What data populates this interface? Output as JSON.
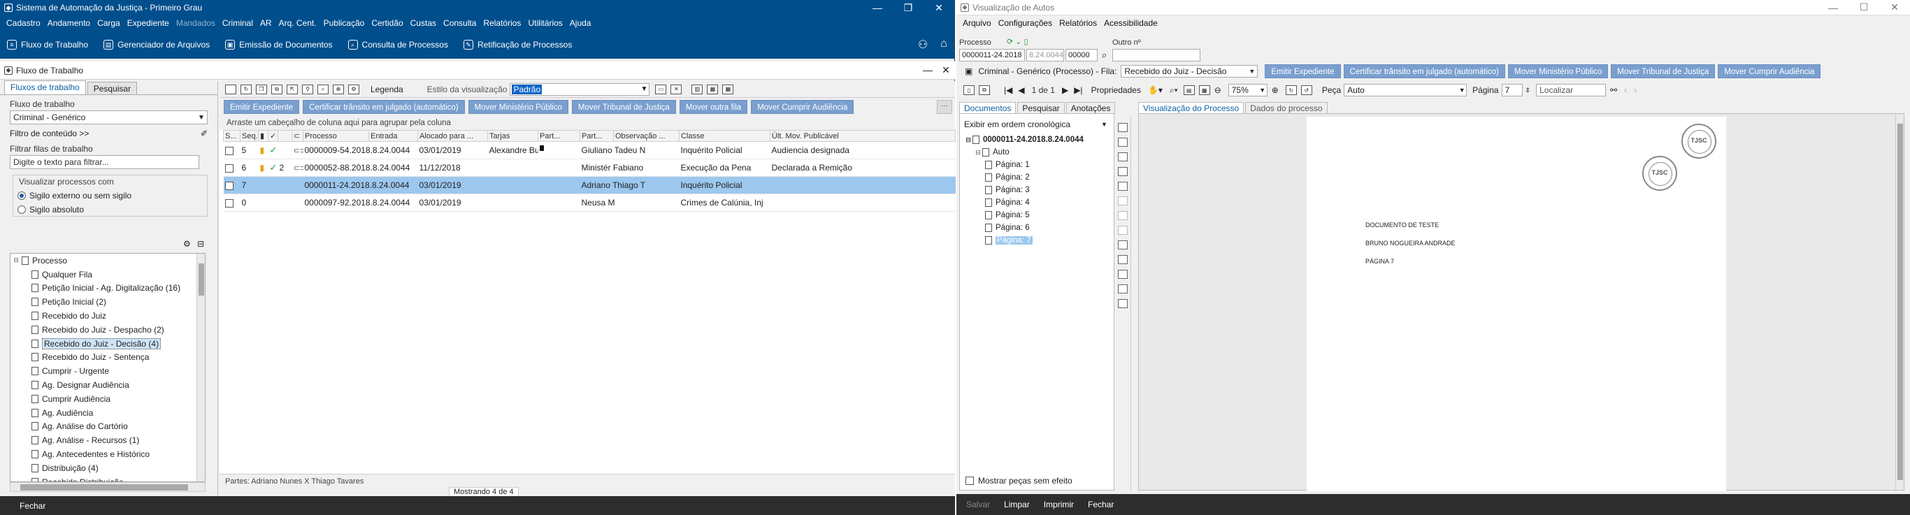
{
  "left_window": {
    "title": "Sistema de Automação da Justiça - Primeiro Grau",
    "controls": [
      "—",
      "❐",
      "✕"
    ],
    "menu": [
      "Cadastro",
      "Andamento",
      "Carga",
      "Expediente",
      "Mandados",
      "Criminal",
      "AR",
      "Arq. Cent.",
      "Publicação",
      "Certidão",
      "Custas",
      "Consulta",
      "Relatórios",
      "Utilitários",
      "Ajuda"
    ],
    "quickbar": [
      {
        "label": "Fluxo de Trabalho",
        "icon": "workflow-icon"
      },
      {
        "label": "Gerenciador de Arquivos",
        "icon": "files-icon"
      },
      {
        "label": "Emissão de Documentos",
        "icon": "document-icon"
      },
      {
        "label": "Consulta de Processos",
        "icon": "search-icon"
      },
      {
        "label": "Retificação de Processos",
        "icon": "edit-icon"
      }
    ],
    "subwindow_title": "Fluxo de Trabalho",
    "side": {
      "tabs": [
        "Fluxos de trabalho",
        "Pesquisar"
      ],
      "fluxo_label": "Fluxo de trabalho",
      "fluxo_value": "Criminal - Genérico",
      "filtro_conteudo": "Filtro de conteúdo >>",
      "filtrar_label": "Filtrar filas de trabalho",
      "filtrar_placeholder": "Digite o texto para filtrar...",
      "visualizar_title": "Visualizar processos com",
      "radio1": "Sigilo externo ou sem sigilo",
      "radio2": "Sigilo absoluto",
      "tree_root": "Processo",
      "tree_items": [
        "Qualquer Fila",
        "Petição Inicial - Ag. Digitalização (16)",
        "Petição Inicial (2)",
        "Recebido do Juiz",
        "Recebido do Juiz - Despacho (2)",
        "Recebido do Juiz - Decisão (4)",
        "Recebido do Juiz - Sentença",
        "Cumprir - Urgente",
        "Ag. Designar Audiência",
        "Cumprir Audiência",
        "Ag. Audiência",
        "Ag. Análise do Cartório",
        "Ag. Análise - Recursos (1)",
        "Ag. Antecedentes e Histórico",
        "Distribuição (4)",
        "Recebido Distribuição"
      ],
      "selected_index": 5
    },
    "toolbar": {
      "legend": "Legenda",
      "estilo_label": "Estilo da visualização",
      "estilo_value": "Padrão"
    },
    "actions": [
      "Emitir Expediente",
      "Certificar trânsito em julgado (automático)",
      "Mover Ministério Público",
      "Mover Tribunal de Justiça",
      "Mover outra fila",
      "Mover Cumprir Audiência"
    ],
    "group_hint": "Arraste um cabeçalho de coluna aqui para agrupar pela coluna",
    "columns": [
      "S...",
      "Seq.",
      "",
      "",
      "",
      "Processo",
      "Entrada",
      "Alocado para ...",
      "Tarjas",
      "Part...",
      "Part...",
      "Observação ...",
      "Classe",
      "Últ. Mov. Publicável"
    ],
    "rows": [
      {
        "seq": "5",
        "flag": true,
        "check": true,
        "num": "",
        "clip": true,
        "processo": "0000009-54.2018.8.24.0044",
        "entrada": "03/01/2019",
        "alocado": "Alexandre Buzan",
        "tarja": true,
        "parte": "Giuliano Tadeu N",
        "classe": "Inquérito Policial",
        "ultmov": "Audiencia designada",
        "selected": false
      },
      {
        "seq": "6",
        "flag": true,
        "check": true,
        "num": "2",
        "clip": true,
        "processo": "0000052-88.2018.8.24.0044",
        "entrada": "11/12/2018",
        "alocado": "",
        "tarja": false,
        "parte": "Ministér Fabiano",
        "classe": "Execução da Pena",
        "ultmov": "Declarada a Remição",
        "selected": false
      },
      {
        "seq": "7",
        "flag": false,
        "check": false,
        "num": "",
        "clip": false,
        "processo": "0000011-24.2018.8.24.0044",
        "entrada": "03/01/2019",
        "alocado": "",
        "tarja": false,
        "parte": "Adriano Thiago T",
        "classe": "Inquérito Policial",
        "ultmov": "",
        "selected": true
      },
      {
        "seq": "0",
        "flag": false,
        "check": false,
        "num": "",
        "clip": false,
        "processo": "0000097-92.2018.8.24.0044",
        "entrada": "03/01/2019",
        "alocado": "",
        "tarja": false,
        "parte": "Neusa M",
        "classe": "Crimes de Calúnia, Inj",
        "ultmov": "",
        "selected": false
      }
    ],
    "partes": "Partes: Adriano Nunes  X  Thiago Tavares",
    "mostrando": "Mostrando 4 de 4",
    "footer_close": "Fechar"
  },
  "right_window": {
    "title": "Visualização de Autos",
    "menu": [
      "Arquivo",
      "Configurações",
      "Relatórios",
      "Acessibilidade"
    ],
    "processo_label": "Processo",
    "outro_label": "Outro nº",
    "processo_parts": [
      "0000011-24.2018",
      "8.24.0044",
      "00000"
    ],
    "fila_path": "Criminal - Genérico (Processo) - Fila:",
    "fila_value": "Recebido do Juiz - Decisão",
    "actions": [
      "Emitir Expediente",
      "Certificar trânsito em julgado (automático)",
      "Mover Ministério Público",
      "Mover Tribunal de Justiça",
      "Mover Cumprir Audiência"
    ],
    "pager": "1 de 1",
    "propriedades": "Propriedades",
    "zoom": "75%",
    "peca_label": "Peça",
    "peca_value": "Auto",
    "pagina_label": "Página",
    "pagina_value": "7",
    "localizar": "Localizar",
    "doc_tabs": [
      "Documentos",
      "Pesquisar",
      "Anotações"
    ],
    "viewer_tabs": [
      "Visualização do Processo",
      "Dados do processo"
    ],
    "order": "Exibir em ordem cronológica",
    "tree_root": "0000011-24.2018.8.24.0044",
    "tree_auto": "Auto",
    "pages": [
      "Página: 1",
      "Página: 2",
      "Página: 3",
      "Página: 4",
      "Página: 5",
      "Página: 6",
      "Página: 7"
    ],
    "mostrar": "Mostrar peças sem efeito",
    "doc_lines": [
      "DOCUMENTO DE TESTE",
      "BRUNO NOGUEIRA ANDRADE",
      "PÁGINA 7"
    ],
    "seal_text": "TJSC",
    "footer": [
      "Salvar",
      "Limpar",
      "Imprimir",
      "Fechar"
    ]
  }
}
